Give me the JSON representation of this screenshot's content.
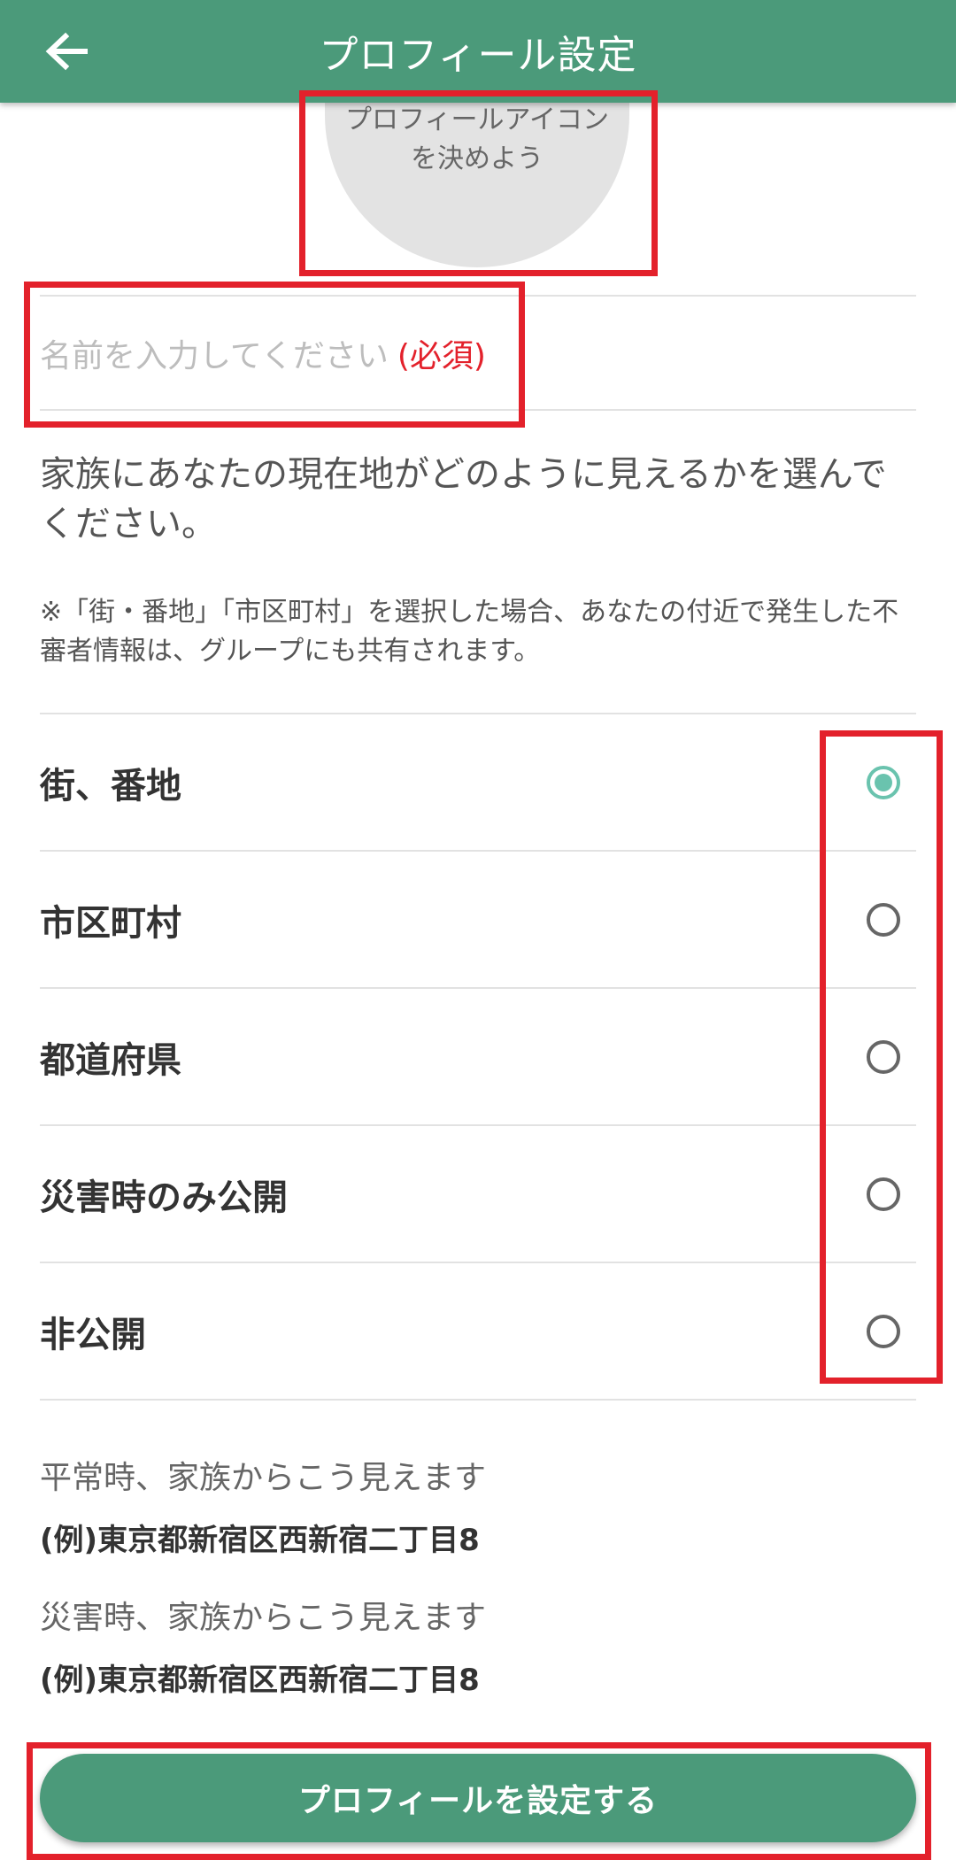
{
  "header": {
    "title": "プロフィール設定",
    "back_icon": "arrow-left-icon"
  },
  "avatar": {
    "placeholder": "プロフィールアイコン\nを決めよう"
  },
  "name_field": {
    "placeholder": "名前を入力してください",
    "required_label": "(必須)"
  },
  "description": "家族にあなたの現在地がどのように見えるかを選んでください。",
  "note": "※「街・番地」「市区町村」を選択した場合、あなたの付近で発生した不審者情報は、グループにも共有されます。",
  "options": [
    {
      "label": "街、番地",
      "selected": true
    },
    {
      "label": "市区町村",
      "selected": false
    },
    {
      "label": "都道府県",
      "selected": false
    },
    {
      "label": "災害時のみ公開",
      "selected": false
    },
    {
      "label": "非公開",
      "selected": false
    }
  ],
  "preview": {
    "normal_label": "平常時、家族からこう見えます",
    "normal_value": "(例)東京都新宿区西新宿二丁目8",
    "disaster_label": "災害時、家族からこう見えます",
    "disaster_value": "(例)東京都新宿区西新宿二丁目8"
  },
  "submit_label": "プロフィールを設定する",
  "colors": {
    "primary": "#4b9a7a",
    "radio_checked": "#6ac3ae",
    "required": "#e3212b",
    "highlight": "#e3212b"
  }
}
